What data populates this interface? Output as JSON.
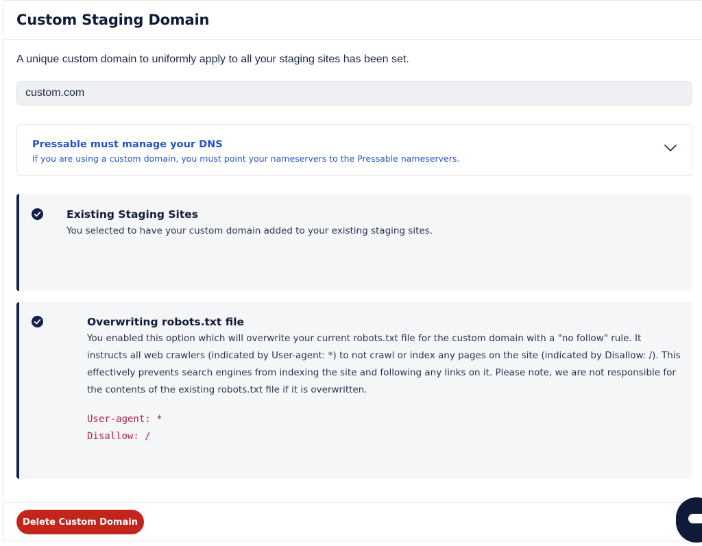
{
  "header": {
    "title": "Custom Staging Domain"
  },
  "intro": {
    "text": "A unique custom domain to uniformly apply to all your staging sites has been set."
  },
  "domain_field": {
    "value": "custom.com"
  },
  "dns_notice": {
    "title": "Pressable must manage your DNS",
    "subtitle": "If you are using a custom domain, you must point your nameservers to the Pressable nameservers.",
    "icon": "chevron-down-icon"
  },
  "cards": [
    {
      "icon": "check-circle-icon",
      "title": "Existing Staging Sites",
      "body": "You selected to have your custom domain added to your existing staging sites."
    },
    {
      "icon": "check-circle-icon",
      "title": "Overwriting robots.txt file",
      "body": "You enabled this option which will overwrite your current robots.txt file for the custom domain with a \"no follow\" rule. It instructs all web crawlers (indicated by User-agent: *) to not crawl or index any pages on the site (indicated by Disallow: /). This effectively prevents search engines from indexing the site and following any links on it. Please note, we are not responsible for the contents of the existing robots.txt file if it is overwritten.",
      "code_lines": [
        "User-agent: *",
        "Disallow: /"
      ]
    }
  ],
  "footer": {
    "delete_label": "Delete Custom Domain"
  },
  "colors": {
    "accent_blue": "#2554c7",
    "navy": "#141f4a",
    "danger": "#c2251c",
    "code": "#b0234a"
  }
}
